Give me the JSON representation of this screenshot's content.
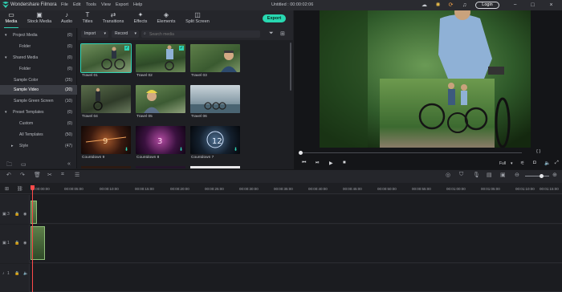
{
  "app": {
    "name": "Wondershare Filmora",
    "document_title": "Untitled : 00:00:02:06"
  },
  "menu": [
    "File",
    "Edit",
    "Tools",
    "View",
    "Export",
    "Help"
  ],
  "titlebar": {
    "login_label": "Login"
  },
  "tabs": [
    {
      "label": "Media",
      "icon": "media-icon",
      "active": true
    },
    {
      "label": "Stock Media",
      "icon": "stock-media-icon"
    },
    {
      "label": "Audio",
      "icon": "audio-icon"
    },
    {
      "label": "Titles",
      "icon": "titles-icon"
    },
    {
      "label": "Transitions",
      "icon": "transitions-icon"
    },
    {
      "label": "Effects",
      "icon": "effects-icon"
    },
    {
      "label": "Elements",
      "icon": "elements-icon"
    },
    {
      "label": "Split Screen",
      "icon": "split-screen-icon"
    }
  ],
  "export_label": "Export",
  "sidebar": {
    "items": [
      {
        "label": "Project Media",
        "count": "(0)",
        "level": 0,
        "expanded": true
      },
      {
        "label": "Folder",
        "count": "(0)",
        "level": 1
      },
      {
        "label": "Shared Media",
        "count": "(0)",
        "level": 0,
        "expanded": true
      },
      {
        "label": "Folder",
        "count": "(0)",
        "level": 1
      },
      {
        "label": "Sample Color",
        "count": "(25)",
        "level": 1
      },
      {
        "label": "Sample Video",
        "count": "(20)",
        "level": 1,
        "selected": true
      },
      {
        "label": "Sample Green Screen",
        "count": "(10)",
        "level": 1
      },
      {
        "label": "Preset Templates",
        "count": "(0)",
        "level": 0,
        "expanded": true
      },
      {
        "label": "Custom",
        "count": "(0)",
        "level": 1
      },
      {
        "label": "All Templates",
        "count": "(50)",
        "level": 1
      },
      {
        "label": "Style",
        "count": "(47)",
        "level": 1,
        "collapsed": true
      }
    ]
  },
  "media_bar": {
    "import_label": "Import",
    "record_label": "Record",
    "search_placeholder": "Search media"
  },
  "clips": [
    {
      "name": "Travel 01",
      "selected": true,
      "checked": true
    },
    {
      "name": "Travel 02",
      "checked": true
    },
    {
      "name": "Travel 03"
    },
    {
      "name": "Travel 04"
    },
    {
      "name": "Travel 05"
    },
    {
      "name": "Travel 06"
    },
    {
      "name": "Countdown 9",
      "download": true
    },
    {
      "name": "Countdown 8",
      "download": true
    },
    {
      "name": "Countdown 7",
      "download": true
    }
  ],
  "preview": {
    "playhead_pos": "{ }",
    "quality": "Full"
  },
  "timeline": {
    "ticks": [
      "00:00:00:00",
      "00:00:05:00",
      "00:00:10:00",
      "00:00:15:00",
      "00:00:20:00",
      "00:00:25:00",
      "00:00:30:00",
      "00:00:35:00",
      "00:00:40:00",
      "00:00:45:00",
      "00:00:50:00",
      "00:00:55:00",
      "00:01:00:00",
      "00:01:05:00",
      "00:01:10:00",
      "00:01:15:00"
    ],
    "tracks": [
      {
        "label": "3"
      },
      {
        "label": "1"
      },
      {
        "label": "1"
      }
    ]
  },
  "colors": {
    "accent": "#2fd3b4",
    "export": "#28d8b1",
    "playhead": "#ff4a4a"
  }
}
